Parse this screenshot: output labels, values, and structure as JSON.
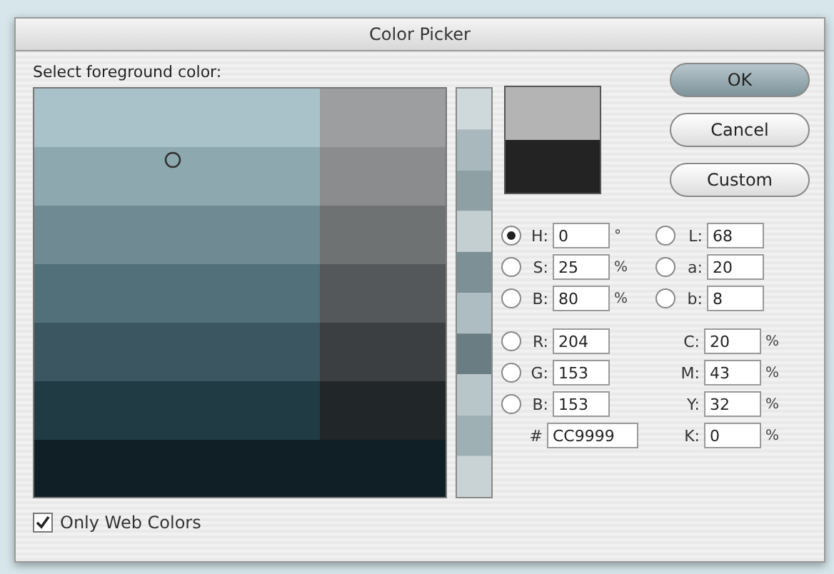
{
  "window": {
    "title": "Color Picker"
  },
  "prompt": "Select foreground color:",
  "buttons": [
    {
      "label": "OK",
      "default": true
    },
    {
      "label": "Cancel",
      "default": false
    },
    {
      "label": "Custom",
      "default": false
    }
  ],
  "rows": [
    [
      {
        "kind": "radio",
        "label": "H:",
        "value": "0",
        "unit": "°",
        "selected": true
      },
      {
        "kind": "radio",
        "label": "L:",
        "value": "68",
        "selected": false
      }
    ],
    [
      {
        "kind": "radio",
        "label": "S:",
        "value": "25",
        "unit": "%",
        "selected": false
      },
      {
        "kind": "radio",
        "label": "a:",
        "value": "20",
        "selected": false
      }
    ],
    [
      {
        "kind": "radio",
        "label": "B:",
        "value": "80",
        "unit": "%",
        "selected": false
      },
      {
        "kind": "radio",
        "label": "b:",
        "value": "8",
        "selected": false
      }
    ],
    [
      {
        "kind": "radio",
        "label": "R:",
        "value": "204",
        "selected": false
      },
      {
        "kind": "plain",
        "label": "C:",
        "value": "20",
        "unit": "%"
      }
    ],
    [
      {
        "kind": "radio",
        "label": "G:",
        "value": "153",
        "selected": false
      },
      {
        "kind": "plain",
        "label": "M:",
        "value": "43",
        "unit": "%"
      }
    ],
    [
      {
        "kind": "radio",
        "label": "B:",
        "value": "153",
        "selected": false
      },
      {
        "kind": "plain",
        "label": "Y:",
        "value": "32",
        "unit": "%"
      }
    ],
    [
      {
        "kind": "hex",
        "label": "#",
        "value": "CC9999"
      },
      {
        "kind": "plain",
        "label": "K:",
        "value": "0",
        "unit": "%"
      }
    ]
  ],
  "only_web_colors": {
    "label": "Only Web Colors",
    "checked": true
  }
}
